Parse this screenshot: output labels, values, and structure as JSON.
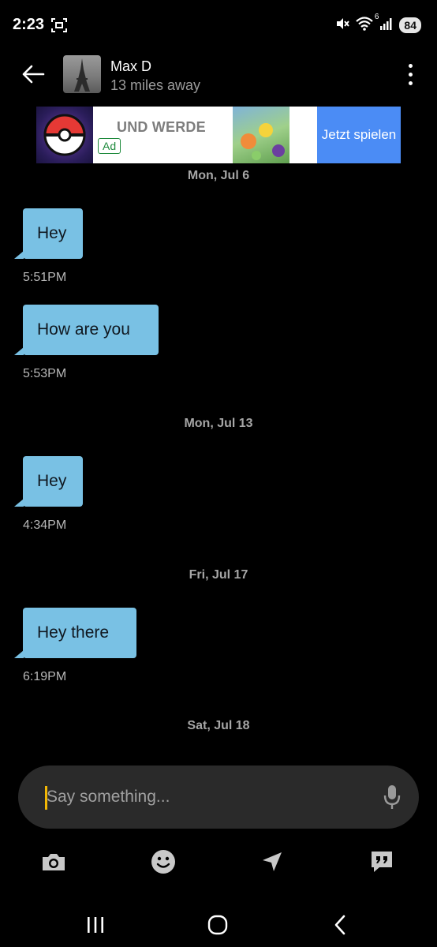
{
  "status_bar": {
    "time": "2:23",
    "network_sup": "6",
    "battery": "84"
  },
  "header": {
    "contact_name": "Max D",
    "distance": "13 miles away",
    "back_icon": "arrow-left-icon",
    "more_icon": "vertical-dots-icon"
  },
  "ad": {
    "headline": "UND WERDE",
    "tag": "Ad",
    "cta": "Jetzt spielen"
  },
  "chat": {
    "dates": [
      "Mon, Jul 6",
      "Mon, Jul 13",
      "Fri, Jul 17",
      "Sat, Jul 18"
    ],
    "messages": [
      {
        "text": "Hey",
        "time": "5:51PM"
      },
      {
        "text": "How are you",
        "time": "5:53PM"
      },
      {
        "text": "Hey",
        "time": "4:34PM"
      },
      {
        "text": "Hey there",
        "time": "6:19PM"
      }
    ]
  },
  "composer": {
    "placeholder": "Say something..."
  },
  "actions": {
    "icons": [
      "camera-icon",
      "smiley-icon",
      "location-arrow-icon",
      "quote-bubble-icon"
    ]
  },
  "colors": {
    "bubble": "#79c1e4",
    "background": "#000000",
    "composer": "#2a2a2a",
    "cta": "#4b8cf5",
    "caret": "#f2b705"
  }
}
